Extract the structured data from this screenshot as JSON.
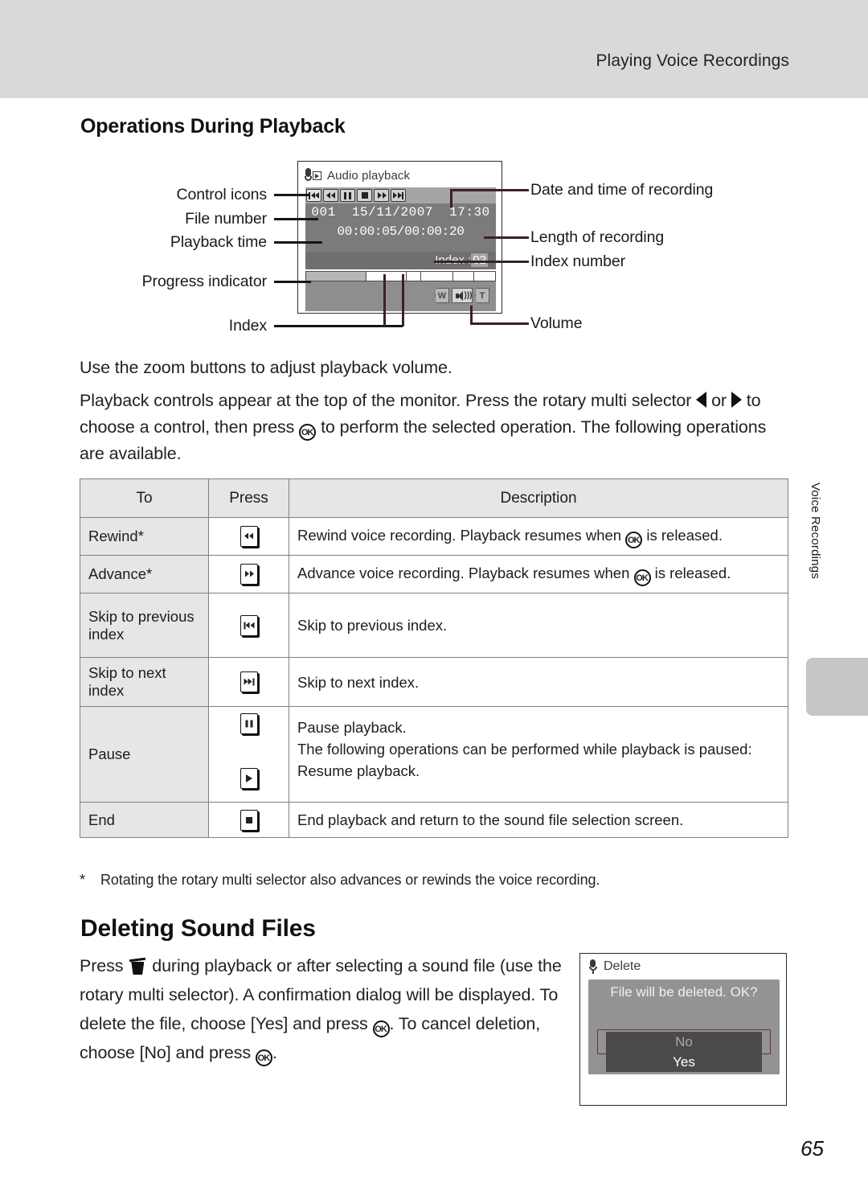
{
  "header": {
    "running_head": "Playing Voice Recordings"
  },
  "side_tab": {
    "label": "Voice Recordings"
  },
  "sections": {
    "operations_heading": "Operations During Playback",
    "deleting_heading": "Deleting Sound Files"
  },
  "paragraphs": {
    "zoom_volume": "Use the zoom buttons to adjust playback volume.",
    "controls_1": "Playback controls appear at the top of the monitor. Press the rotary multi selector",
    "controls_2_or": "or",
    "controls_3": "to choose a control, then press",
    "controls_4": "to perform the selected operation. The following operations are available.",
    "footnote_star": "*",
    "footnote": "Rotating the rotary multi selector also advances or rewinds the voice recording.",
    "delete_1": "Press",
    "delete_2": "during playback or after selecting a sound file (use the rotary multi selector). A confirmation dialog will be displayed. To delete the file, choose [Yes] and press",
    "delete_3": ". To cancel deletion, choose [No] and press",
    "delete_4": "."
  },
  "diagram": {
    "screen": {
      "title": "Audio playback",
      "title_icon": "microphone-playback-icon",
      "file_number": "001",
      "date": "15/11/2007",
      "time": "17:30",
      "playback_time": "00:00:05/00:00:20",
      "index_label": "Index :",
      "index_number": "02",
      "control_icons": [
        "skip-previous-icon",
        "rewind-icon",
        "pause-icon",
        "stop-icon",
        "advance-icon",
        "skip-next-icon"
      ],
      "progress_segments": [
        {
          "state": "filled",
          "width": 32
        },
        {
          "state": "empty",
          "width": 21
        },
        {
          "state": "empty",
          "width": 8
        },
        {
          "state": "empty",
          "width": 17
        },
        {
          "state": "empty",
          "width": 11
        },
        {
          "state": "empty",
          "width": 11
        }
      ],
      "volume_icons": [
        "wide-zoom-icon",
        "speaker-icon",
        "tele-zoom-icon"
      ]
    },
    "callouts_left": [
      "Control icons",
      "File number",
      "Playback time",
      "Progress indicator",
      "Index"
    ],
    "callouts_right": [
      "Date and time of recording",
      "Length of recording",
      "Index number",
      "Volume"
    ]
  },
  "table": {
    "headers": [
      "To",
      "Press",
      "Description"
    ],
    "rows": [
      {
        "to": "Rewind*",
        "press_icons": [
          "rewind-icon"
        ],
        "desc_lines": [
          "Rewind voice recording. Playback resumes when {OK} is released."
        ]
      },
      {
        "to": "Advance*",
        "press_icons": [
          "advance-icon"
        ],
        "desc_lines": [
          "Advance voice recording. Playback resumes when {OK} is released."
        ]
      },
      {
        "to": "Skip to previous index",
        "press_icons": [
          "skip-previous-icon"
        ],
        "desc_lines": [
          "Skip to previous index."
        ]
      },
      {
        "to": "Skip to next index",
        "press_icons": [
          "skip-next-icon"
        ],
        "desc_lines": [
          "Skip to next index."
        ]
      },
      {
        "to": "Pause",
        "press_icons": [
          "pause-icon",
          "play-icon"
        ],
        "desc_lines": [
          "Pause playback.",
          "The following operations can be performed while playback is paused:",
          "Resume playback."
        ]
      },
      {
        "to": "End",
        "press_icons": [
          "stop-icon"
        ],
        "desc_lines": [
          "End playback and return to the sound file selection screen."
        ]
      }
    ]
  },
  "delete_dialog": {
    "title": "Delete",
    "title_icon": "microphone-icon",
    "message": "File will be deleted. OK?",
    "options": [
      "No",
      "Yes"
    ],
    "selected_option": "No"
  },
  "page_number": "65",
  "colors": {
    "header_band": "#d9d9d9",
    "table_header": "#e6e6e6",
    "screen_info": "#7b7b7b",
    "dialog_body": "#939393",
    "selection_ring": "#6b2f2f"
  }
}
